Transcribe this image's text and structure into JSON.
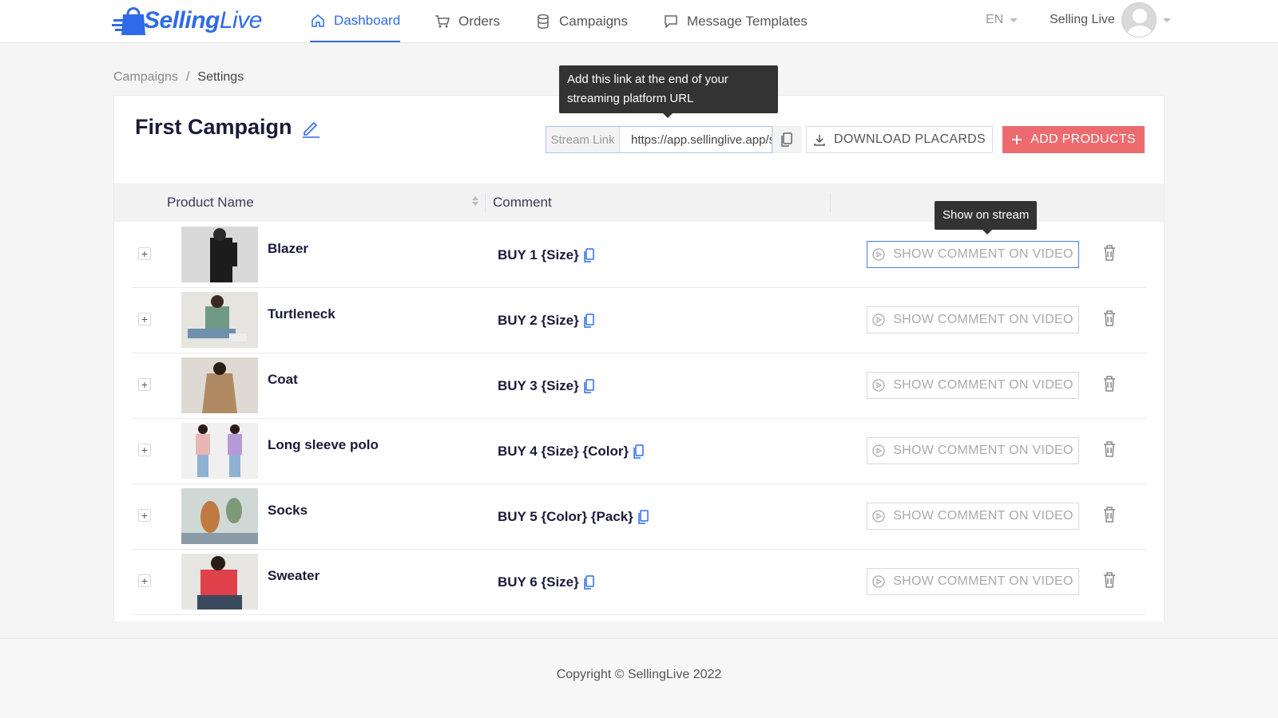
{
  "brand": {
    "name_bold": "Selling",
    "name_light": "Live"
  },
  "nav": {
    "items": [
      {
        "label": "Dashboard",
        "icon": "home-icon",
        "active": true
      },
      {
        "label": "Orders",
        "icon": "cart-icon",
        "active": false
      },
      {
        "label": "Campaigns",
        "icon": "database-icon",
        "active": false
      },
      {
        "label": "Message Templates",
        "icon": "message-icon",
        "active": false
      }
    ],
    "language": "EN",
    "user_name": "Selling Live"
  },
  "breadcrumb": {
    "parent": "Campaigns",
    "separator": "/",
    "current": "Settings"
  },
  "campaign": {
    "title": "First Campaign",
    "stream_label": "Stream Link",
    "stream_value": "https://app.sellinglive.app/s/first-campaign",
    "download_label": "DOWNLOAD PLACARDS",
    "add_label": "ADD PRODUCTS"
  },
  "tooltips": {
    "stream": "Add this link at the end of your streaming platform URL",
    "show": "Show on stream"
  },
  "table": {
    "columns": {
      "name": "Product Name",
      "comment": "Comment"
    },
    "show_label": "SHOW COMMENT ON VIDEO",
    "rows": [
      {
        "name": "Blazer",
        "comment": "BUY 1 {Size}"
      },
      {
        "name": "Turtleneck",
        "comment": "BUY 2 {Size}"
      },
      {
        "name": "Coat",
        "comment": "BUY 3 {Size}"
      },
      {
        "name": "Long sleeve polo",
        "comment": "BUY 4 {Size} {Color}"
      },
      {
        "name": "Socks",
        "comment": "BUY 5 {Color} {Pack}"
      },
      {
        "name": "Sweater",
        "comment": "BUY 6 {Size}"
      }
    ]
  },
  "footer": {
    "copyright": "Copyright © SellingLive 2022"
  },
  "colors": {
    "primary": "#2f6be8",
    "danger": "#ec6b6f",
    "text": "#1a1a3a"
  }
}
